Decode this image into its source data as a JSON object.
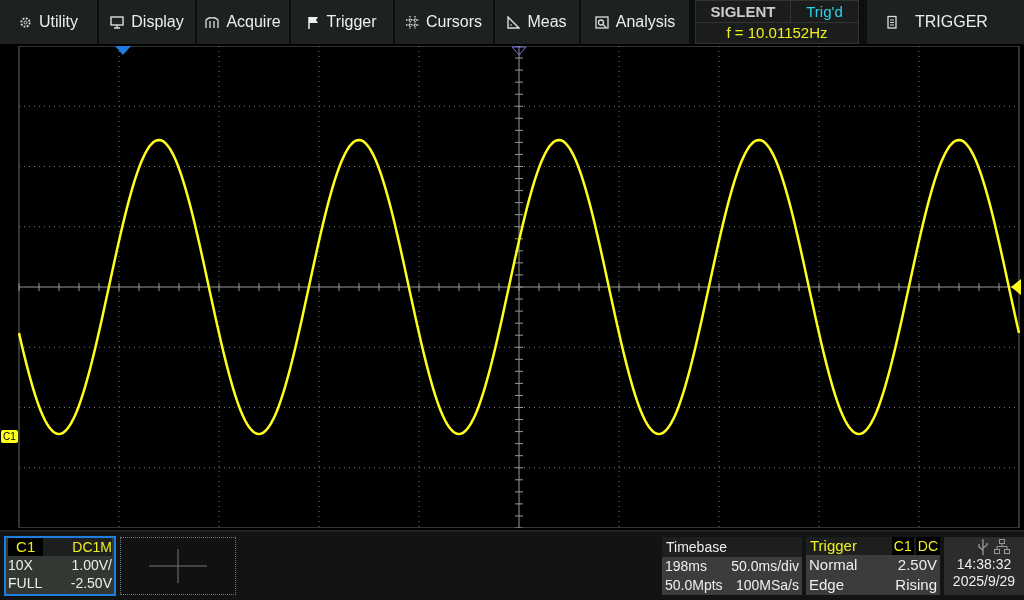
{
  "menu": [
    {
      "label": "Utility"
    },
    {
      "label": "Display"
    },
    {
      "label": "Acquire"
    },
    {
      "label": "Trigger"
    },
    {
      "label": "Cursors"
    },
    {
      "label": "Meas"
    },
    {
      "label": "Analysis"
    }
  ],
  "status": {
    "brand": "SIGLENT",
    "trigger_state": "Trig'd",
    "frequency": "f = 10.01152Hz"
  },
  "side_button": {
    "label": "TRIGGER"
  },
  "channel_marker": "C1",
  "channel": {
    "name": "C1",
    "coupling": "DC1M",
    "probe": "10X",
    "scale": "1.00V/",
    "bandwidth": "FULL",
    "offset": "-2.50V",
    "selected": true
  },
  "timebase": {
    "title": "Timebase",
    "delay": "198ms",
    "scale": "50.0ms/div",
    "memory": "50.0Mpts",
    "sample_rate": "100MSa/s"
  },
  "trigger": {
    "title": "Trigger",
    "source": "C1",
    "coupling": "DC",
    "mode": "Normal",
    "level": "2.50V",
    "type": "Edge",
    "slope": "Rising"
  },
  "clock": {
    "time": "14:38:32",
    "date": "2025/9/29"
  }
}
